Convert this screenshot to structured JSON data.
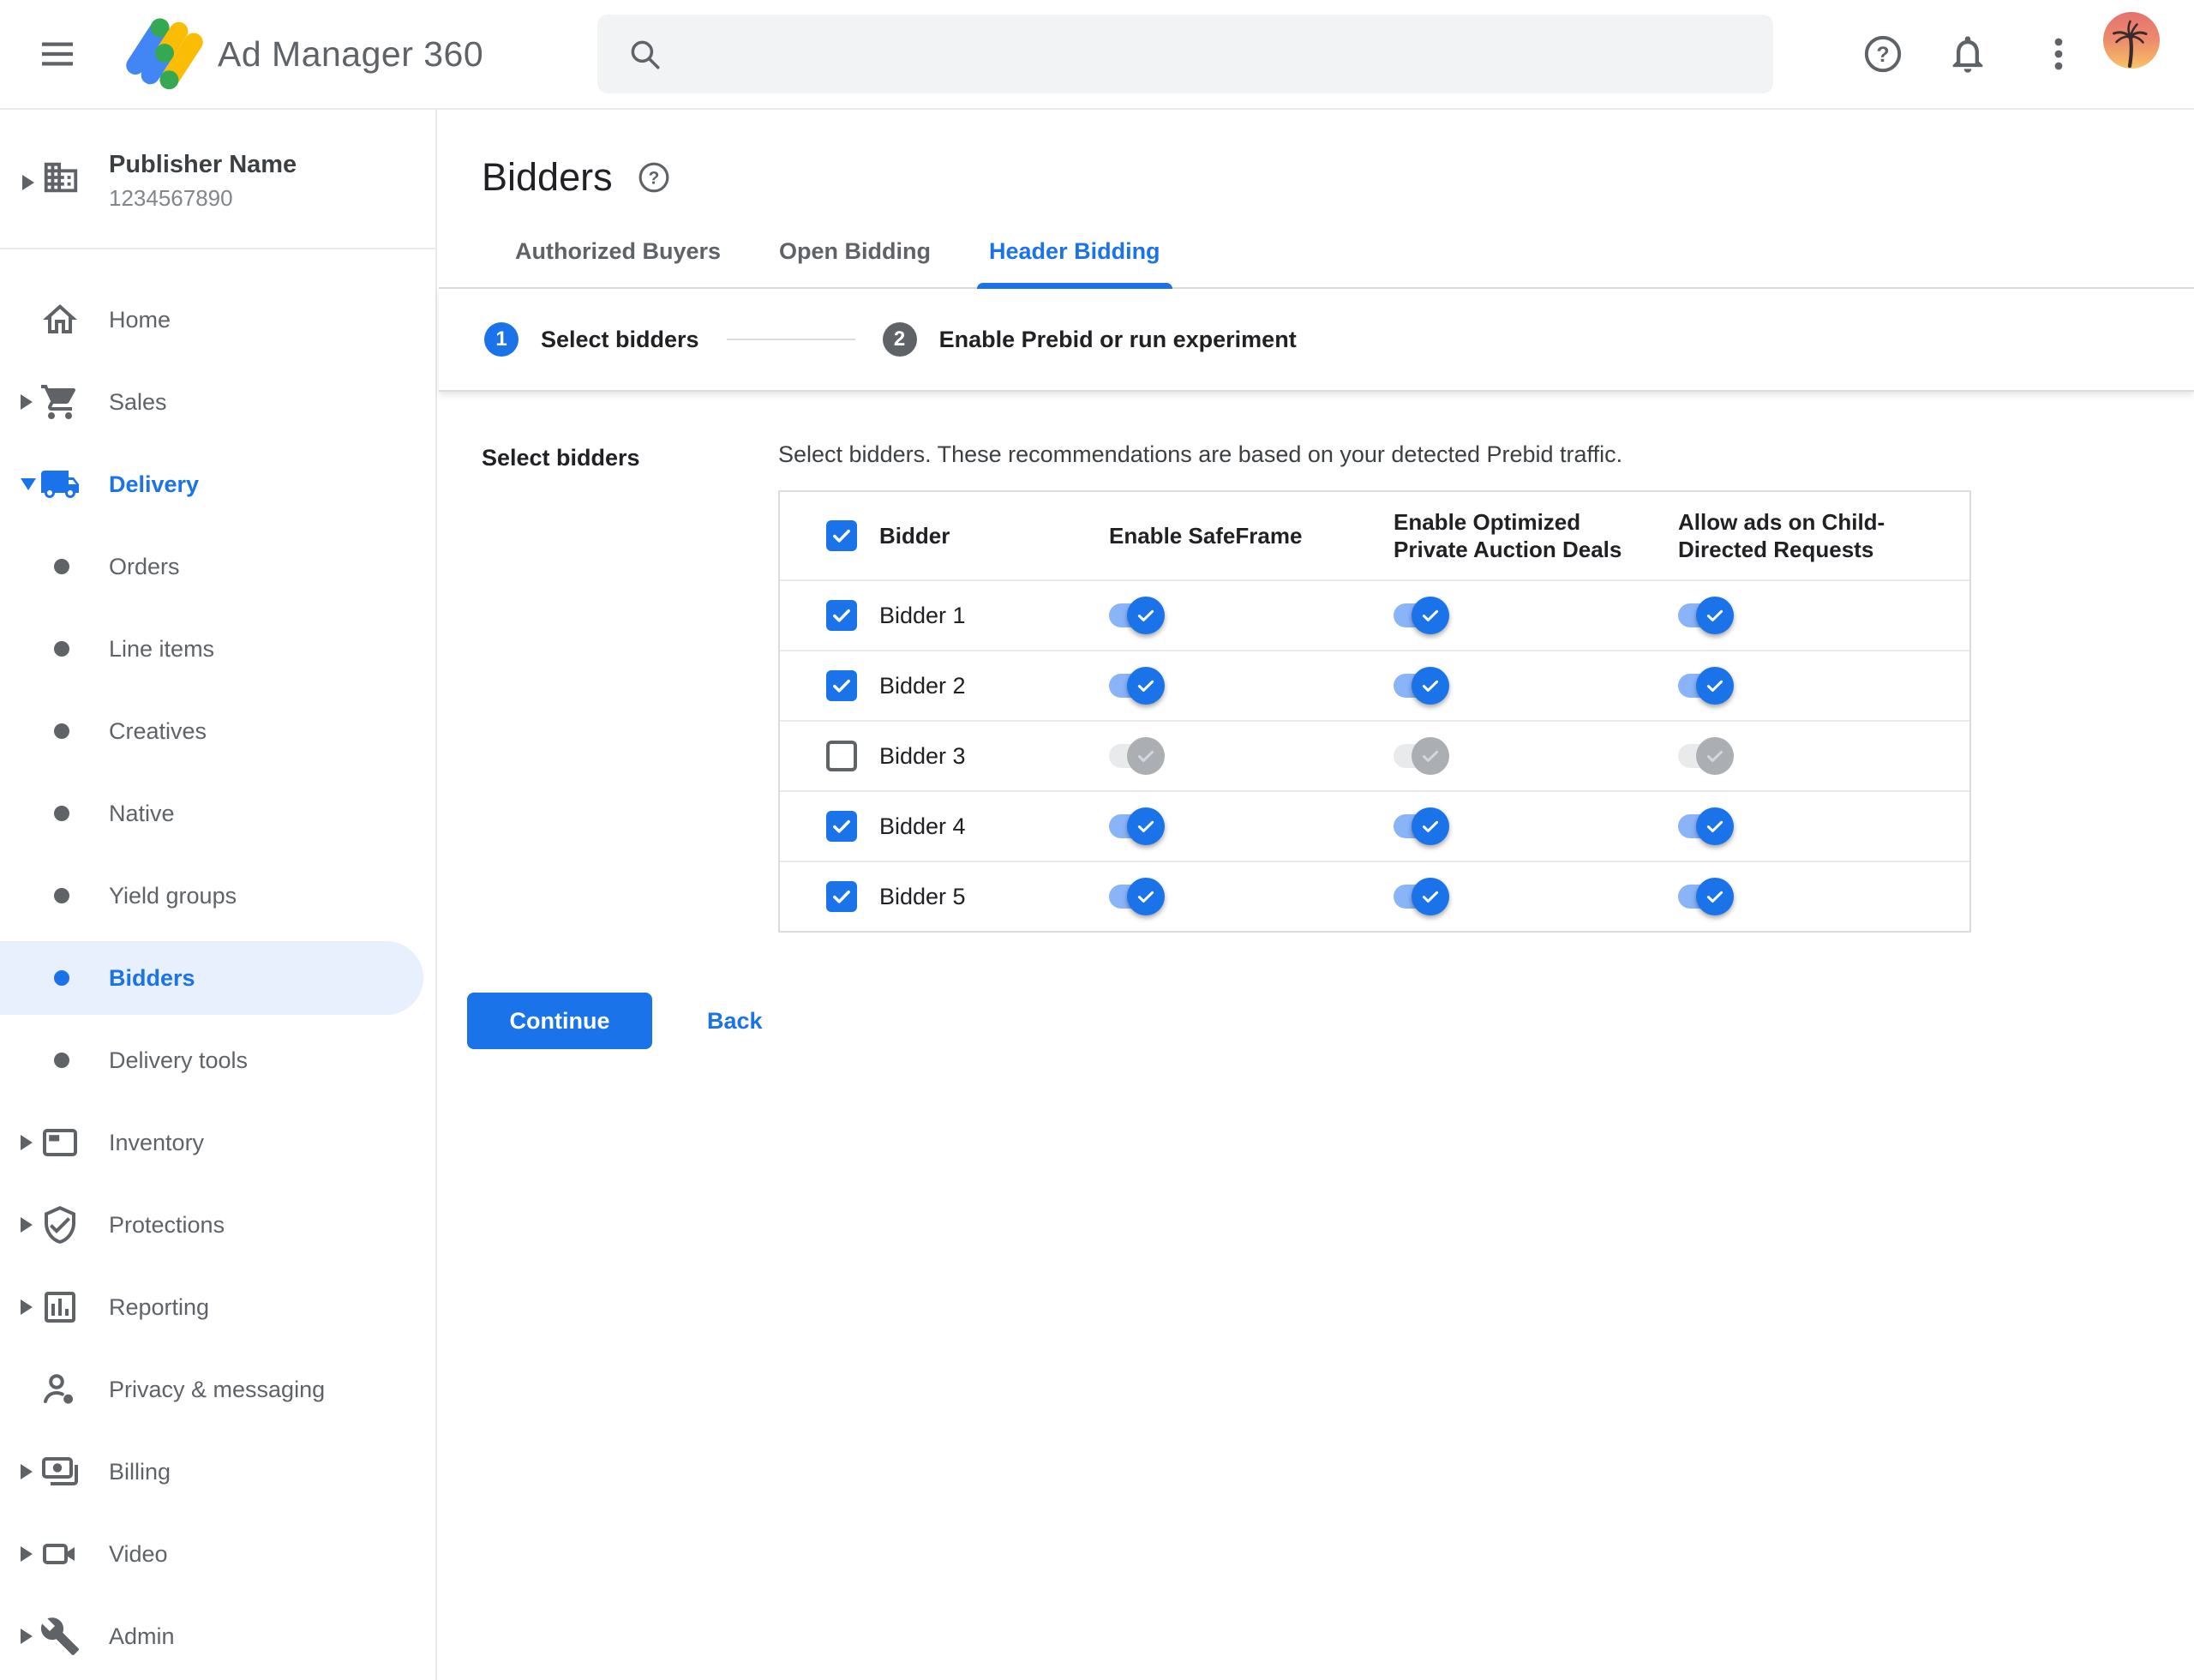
{
  "topbar": {
    "app_name": "Ad Manager 360",
    "search_placeholder": ""
  },
  "sidebar": {
    "publisher_name": "Publisher Name",
    "publisher_id": "1234567890",
    "items": [
      {
        "label": "Home"
      },
      {
        "label": "Sales",
        "expandable": true
      },
      {
        "label": "Delivery",
        "expandable": true,
        "expanded": true
      },
      {
        "label": "Orders"
      },
      {
        "label": "Line items"
      },
      {
        "label": "Creatives"
      },
      {
        "label": "Native"
      },
      {
        "label": "Yield groups"
      },
      {
        "label": "Bidders",
        "selected": true
      },
      {
        "label": "Delivery tools"
      },
      {
        "label": "Inventory",
        "expandable": true
      },
      {
        "label": "Protections",
        "expandable": true
      },
      {
        "label": "Reporting",
        "expandable": true
      },
      {
        "label": "Privacy & messaging"
      },
      {
        "label": "Billing",
        "expandable": true
      },
      {
        "label": "Video",
        "expandable": true
      },
      {
        "label": "Admin",
        "expandable": true
      }
    ]
  },
  "main": {
    "title": "Bidders",
    "tabs": [
      {
        "label": "Authorized Buyers",
        "active": false
      },
      {
        "label": "Open Bidding",
        "active": false
      },
      {
        "label": "Header Bidding",
        "active": true
      }
    ],
    "stepper": [
      {
        "number": "1",
        "label": "Select bidders",
        "state": "active"
      },
      {
        "number": "2",
        "label": "Enable Prebid or run experiment",
        "state": "upcoming"
      }
    ],
    "section_label": "Select bidders",
    "description": "Select bidders. These recommendations are based on your detected Prebid traffic.",
    "table": {
      "header_checkbox_checked": true,
      "columns": [
        "Bidder",
        "Enable SafeFrame",
        "Enable Optimized Private Auction Deals",
        "Allow ads on Child-Directed Requests"
      ],
      "rows": [
        {
          "name": "Bidder 1",
          "checked": true,
          "safeframe_on": true,
          "optimized_on": true,
          "child_directed_on": true,
          "toggles_enabled": true
        },
        {
          "name": "Bidder 2",
          "checked": true,
          "safeframe_on": true,
          "optimized_on": true,
          "child_directed_on": true,
          "toggles_enabled": true
        },
        {
          "name": "Bidder 3",
          "checked": false,
          "safeframe_on": true,
          "optimized_on": true,
          "child_directed_on": true,
          "toggles_enabled": false
        },
        {
          "name": "Bidder 4",
          "checked": true,
          "safeframe_on": true,
          "optimized_on": true,
          "child_directed_on": true,
          "toggles_enabled": true
        },
        {
          "name": "Bidder 5",
          "checked": true,
          "safeframe_on": true,
          "optimized_on": true,
          "child_directed_on": true,
          "toggles_enabled": true
        }
      ]
    },
    "continue_label": "Continue",
    "back_label": "Back"
  },
  "colors": {
    "accent_blue": "#1a73e8",
    "selected_item_bg": "#e8f0fe",
    "toggle_track_on": "#8ab4f8",
    "toggle_track_disabled": "#e9eaec",
    "toggle_thumb_disabled": "#abaeb2",
    "icon_gray": "#5f6368",
    "divider": "#dadce0"
  }
}
